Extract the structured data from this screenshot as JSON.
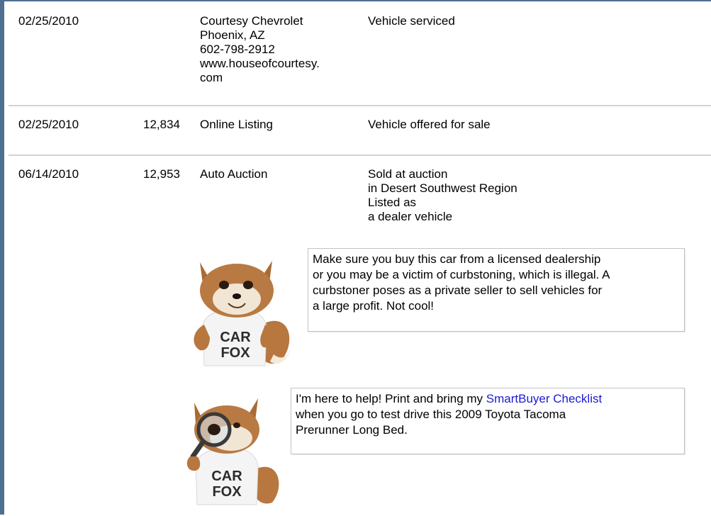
{
  "records": [
    {
      "date": "02/25/2010",
      "odometer": "",
      "source_lines": [
        "Courtesy Chevrolet",
        "Phoenix, AZ",
        "602-798-2912",
        "www.houseofcourtesy.",
        "com"
      ],
      "detail_lines": [
        "Vehicle serviced"
      ]
    },
    {
      "date": "02/25/2010",
      "odometer": "12,834",
      "source_lines": [
        "Online Listing"
      ],
      "detail_lines": [
        "Vehicle offered for sale"
      ]
    },
    {
      "date": "06/14/2010",
      "odometer": "12,953",
      "source_lines": [
        "Auto Auction"
      ],
      "detail_lines": [
        "Sold at auction",
        "in Desert Southwest Region",
        "Listed as",
        "a dealer vehicle"
      ]
    }
  ],
  "fox": {
    "shirt_line1": "CAR",
    "shirt_line2": "FOX"
  },
  "tips": {
    "curbstoning_lines": [
      "Make sure you buy this car from a licensed dealership",
      "or you may be a victim of curbstoning, which is illegal. A",
      "curbstoner poses as a private seller to sell vehicles for",
      "a large profit. Not cool!"
    ],
    "checklist_prefix": "I'm here to help! Print and bring my ",
    "checklist_link": "SmartBuyer Checklist",
    "checklist_lines": [
      "when you go to test drive this 2009 Toyota Tacoma",
      "Prerunner Long Bed."
    ]
  },
  "colors": {
    "frame_border": "#4f6f91",
    "row_divider": "#cfd3d8",
    "link": "#1a1ad6"
  }
}
